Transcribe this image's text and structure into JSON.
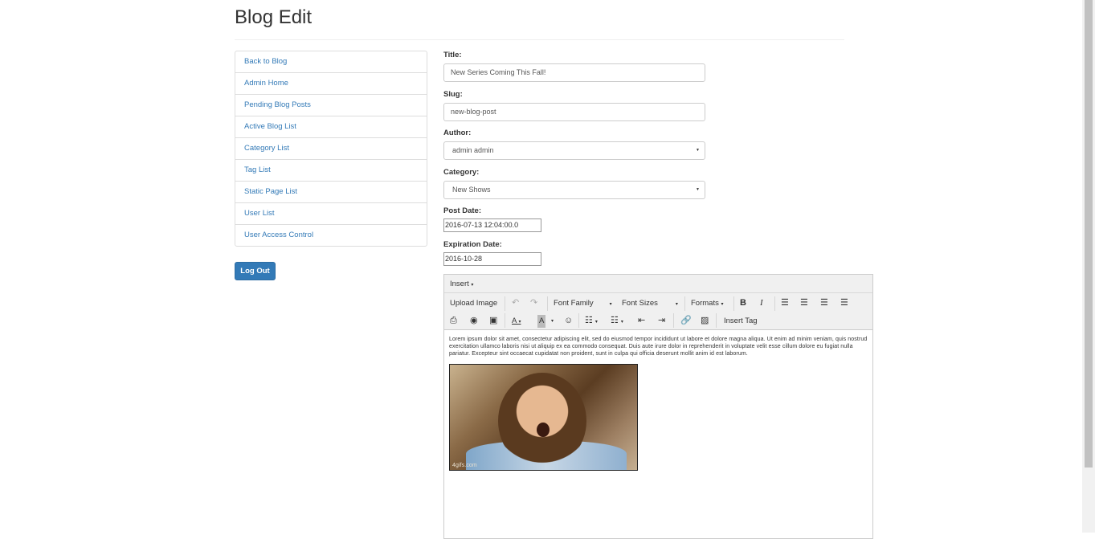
{
  "page": {
    "title": "Blog Edit"
  },
  "nav": {
    "items": [
      "Back to Blog",
      "Admin Home",
      "Pending Blog Posts",
      "Active Blog List",
      "Category List",
      "Tag List",
      "Static Page List",
      "User List",
      "User Access Control"
    ],
    "logout_label": "Log Out"
  },
  "form": {
    "title_label": "Title:",
    "title_value": "New Series Coming This Fall!",
    "slug_label": "Slug:",
    "slug_value": "new-blog-post",
    "author_label": "Author:",
    "author_value": "admin admin",
    "category_label": "Category:",
    "category_value": "New Shows",
    "post_date_label": "Post Date:",
    "post_date_value": "2016-07-13 12:04:00.0",
    "expiration_label": "Expiration Date:",
    "expiration_value": "2016-10-28"
  },
  "editor": {
    "menu_insert": "Insert",
    "upload_image": "Upload Image",
    "font_family": "Font Family",
    "font_sizes": "Font Sizes",
    "formats": "Formats",
    "insert_tag": "Insert Tag",
    "body_text": "Lorem ipsum dolor sit amet, consectetur adipiscing elit, sed do eiusmod tempor incididunt ut labore et dolore magna aliqua. Ut enim ad minim veniam, quis nostrud exercitation ullamco laboris nisi ut aliquip ex ea commodo consequat. Duis aute irure dolor in reprehenderit in voluptate velit esse cillum dolore eu fugiat nulla pariatur. Excepteur sint occaecat cupidatat non proident, sunt in culpa qui officia deserunt mollit anim id est laborum.",
    "image_watermark": "4gifs.com"
  },
  "icons": {
    "undo": "undo-icon",
    "redo": "redo-icon",
    "bold": "bold-icon",
    "italic": "italic-icon",
    "print": "print-icon",
    "preview": "preview-icon",
    "media": "media-icon",
    "emoticon": "emoticon-icon",
    "link": "link-icon",
    "image": "image-icon"
  },
  "colors": {
    "link": "#337ab7",
    "primary_button": "#337ab7"
  }
}
